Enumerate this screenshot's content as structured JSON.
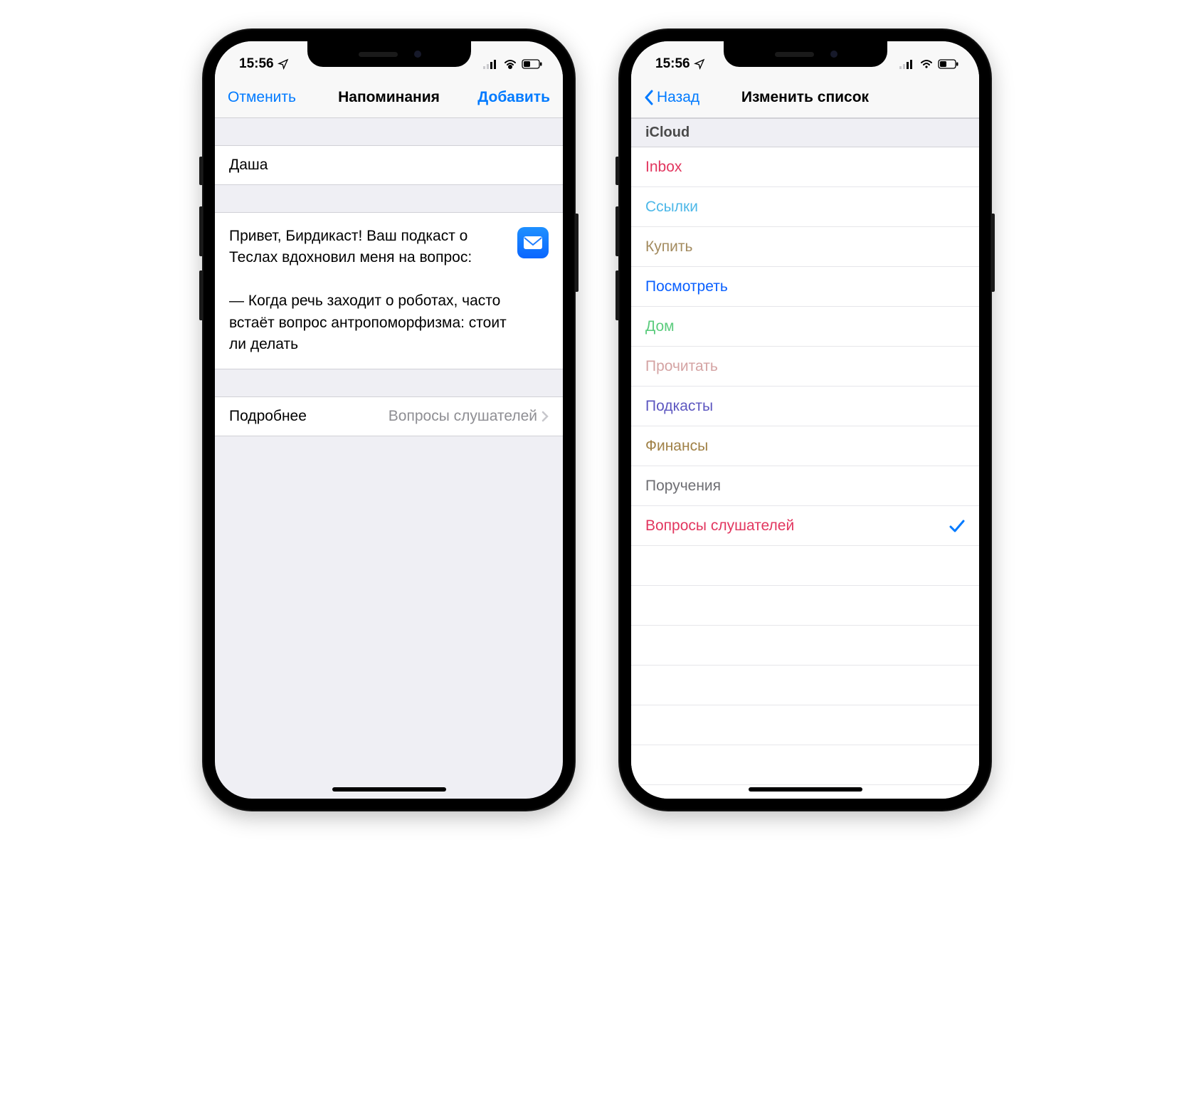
{
  "status": {
    "time": "15:56",
    "location_icon": "location-arrow"
  },
  "phone1": {
    "nav": {
      "cancel": "Отменить",
      "title": "Напоминания",
      "add": "Добавить"
    },
    "title_field": "Даша",
    "note": "Привет, Бирдикаст! Ваш подкаст о Теслах вдохновил меня на вопрос:\n\n— Когда речь заходит о роботах, часто встаёт вопрос антропоморфизма: стоит ли делать",
    "more_label": "Подробнее",
    "more_value": "Вопросы слушателей"
  },
  "phone2": {
    "nav": {
      "back": "Назад",
      "title": "Изменить список"
    },
    "section": "iCloud",
    "lists": [
      {
        "label": "Inbox",
        "color": "#e2365f",
        "selected": false
      },
      {
        "label": "Ссылки",
        "color": "#4db8e8",
        "selected": false
      },
      {
        "label": "Купить",
        "color": "#a38b5f",
        "selected": false
      },
      {
        "label": "Посмотреть",
        "color": "#0a60ff",
        "selected": false
      },
      {
        "label": "Дом",
        "color": "#5ccc7e",
        "selected": false
      },
      {
        "label": "Прочитать",
        "color": "#d4a3a3",
        "selected": false
      },
      {
        "label": "Подкасты",
        "color": "#5d57c0",
        "selected": false
      },
      {
        "label": "Финансы",
        "color": "#a08147",
        "selected": false
      },
      {
        "label": "Поручения",
        "color": "#6e6e73",
        "selected": false
      },
      {
        "label": "Вопросы слушателей",
        "color": "#e2365f",
        "selected": true
      }
    ]
  }
}
